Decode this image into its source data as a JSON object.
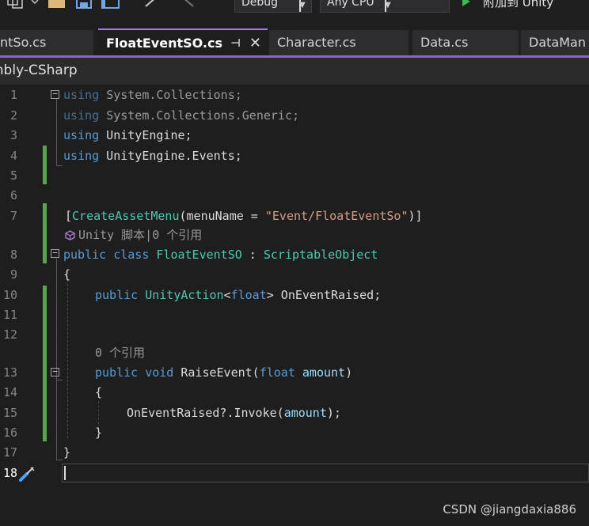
{
  "toolbar": {
    "config_value": "Debug",
    "platform_value": "Any CPU",
    "run_label": "附加到 Unity"
  },
  "tabs": [
    {
      "label": "ntSo.cs"
    },
    {
      "label": "FloatEventSO.cs"
    },
    {
      "label": "Character.cs"
    },
    {
      "label": "Data.cs"
    },
    {
      "label": "DataMan"
    }
  ],
  "active_tab": {
    "pin": "⊣",
    "close": "✕"
  },
  "navbar": {
    "project": "mbly-CSharp"
  },
  "code_lines": [
    {
      "n": "1",
      "text": "using System.Collections;"
    },
    {
      "n": "2",
      "text": "using System.Collections.Generic;"
    },
    {
      "n": "3",
      "text": "using UnityEngine;"
    },
    {
      "n": "4",
      "text": "using UnityEngine.Events;"
    },
    {
      "n": "5",
      "text": ""
    },
    {
      "n": "6",
      "text": ""
    },
    {
      "n": "7",
      "text": "[CreateAssetMenu(menuName = \"Event/FloatEventSo\")]"
    },
    {
      "n": "8",
      "text": "public class FloatEventSO : ScriptableObject"
    },
    {
      "n": "9",
      "text": "{"
    },
    {
      "n": "10",
      "text": "public UnityAction<float> OnEventRaised;"
    },
    {
      "n": "11",
      "text": ""
    },
    {
      "n": "12",
      "text": ""
    },
    {
      "n": "13",
      "text": "public void RaiseEvent(float amount)"
    },
    {
      "n": "14",
      "text": "{"
    },
    {
      "n": "15",
      "text": "OnEventRaised?.Invoke(amount);"
    },
    {
      "n": "16",
      "text": "}"
    },
    {
      "n": "17",
      "text": "}"
    },
    {
      "n": "18",
      "text": ""
    }
  ],
  "codelens": {
    "class_lens": "Unity 脚本|0 个引用",
    "method_lens": "0 个引用"
  },
  "watermark": "CSDN @jiangdaxia886",
  "colors": {
    "keyword": "#569cd6",
    "type": "#4ec9b0",
    "string": "#d69d85",
    "change_bar": "#57a64a",
    "tab_accent": "#a277ff"
  }
}
